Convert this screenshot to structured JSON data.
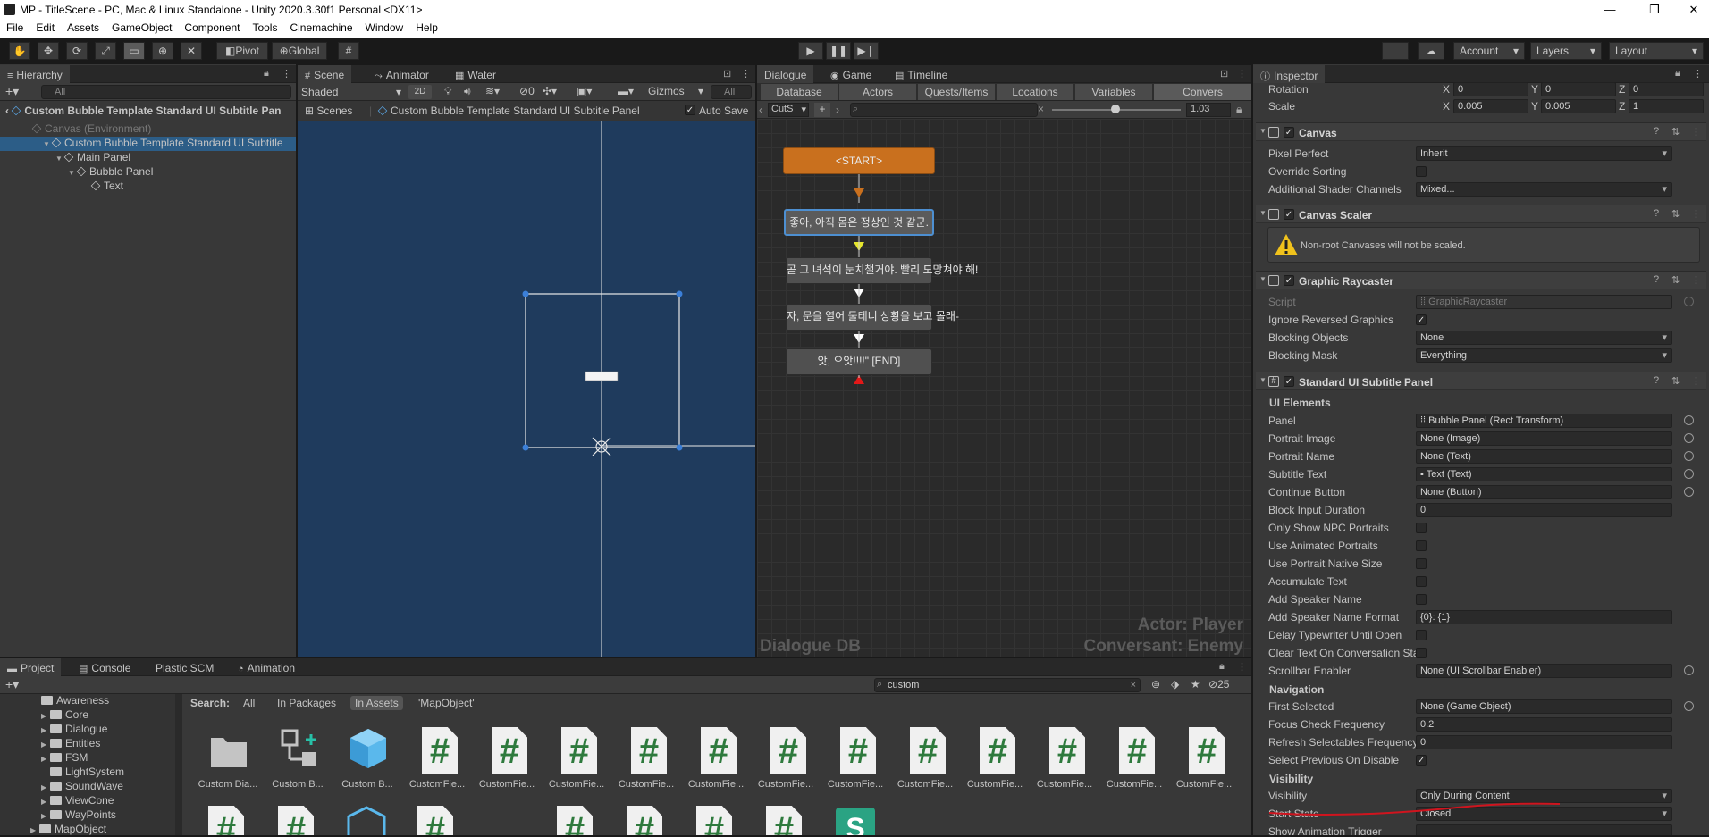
{
  "window": {
    "title": "MP - TitleScene - PC, Mac & Linux Standalone - Unity 2020.3.30f1 Personal <DX11>"
  },
  "menu": [
    "File",
    "Edit",
    "Assets",
    "GameObject",
    "Component",
    "Tools",
    "Cinemachine",
    "Window",
    "Help"
  ],
  "toolbar": {
    "pivot": "Pivot",
    "global": "Global",
    "account": "Account",
    "layers": "Layers",
    "layout": "Layout"
  },
  "hierarchy": {
    "tab": "Hierarchy",
    "search_placeholder": "All",
    "scene_header": "Custom Bubble Template Standard UI Subtitle Pan",
    "items": [
      {
        "label": "Canvas (Environment)"
      },
      {
        "label": "Custom Bubble Template Standard UI Subtitle"
      },
      {
        "label": "Main Panel"
      },
      {
        "label": "Bubble Panel"
      },
      {
        "label": "Text"
      }
    ]
  },
  "scene": {
    "tabs": [
      "Scene",
      "Animator",
      "Water"
    ],
    "shading": "Shaded",
    "mode_2d": "2D",
    "hidden_count": "0",
    "gizmos": "Gizmos",
    "search_placeholder": "All",
    "breadcrumb_root": "Scenes",
    "breadcrumb_prefab": "Custom Bubble Template Standard UI Subtitle Panel",
    "auto_save": "Auto Save"
  },
  "dialogue": {
    "tabs": [
      "Dialogue",
      "Game",
      "Timeline"
    ],
    "subtabs": [
      "Database",
      "Actors",
      "Quests/Items",
      "Locations",
      "Variables",
      "Convers"
    ],
    "conversation": "CutS",
    "add": "+",
    "zoom": "1.03",
    "nodes": {
      "start": "<START>",
      "n1": "좋아, 아직 몸은 정상인 것 같군.",
      "n2": "곧 그 녀석이 눈치챌거야. 빨리 도망쳐야 해!",
      "n3": "자, 문을 열어 둘테니 상황을 보고 몰래-",
      "n4": "앗, 으앗!!!!\" [END]"
    },
    "db_label": "Dialogue DB",
    "actor": "Actor: Player",
    "conversant": "Conversant: Enemy"
  },
  "project": {
    "tabs": [
      "Project",
      "Console",
      "Plastic SCM",
      "Animation"
    ],
    "search_value": "custom",
    "hidden_count": "25",
    "search_label": "Search:",
    "filters": [
      "All",
      "In Packages",
      "In Assets",
      "'MapObject'"
    ],
    "tree": [
      "Awareness",
      "Core",
      "Dialogue",
      "Entities",
      "FSM",
      "LightSystem",
      "SoundWave",
      "ViewCone",
      "WayPoints",
      "MapObject"
    ],
    "assets": [
      "Custom Dia...",
      "Custom B...",
      "Custom B...",
      "CustomFie...",
      "CustomFie...",
      "CustomFie...",
      "CustomFie...",
      "CustomFie...",
      "CustomFie...",
      "CustomFie...",
      "CustomFie...",
      "CustomFie...",
      "CustomFie...",
      "CustomFie...",
      "CustomFie..."
    ]
  },
  "inspector": {
    "tab": "Inspector",
    "transform": {
      "rotation_label": "Rotation",
      "rx": "0",
      "ry": "0",
      "rz": "0",
      "scale_label": "Scale",
      "sx": "0.005",
      "sy": "0.005",
      "sz": "1"
    },
    "canvas": {
      "title": "Canvas",
      "pixel_perfect": "Pixel Perfect",
      "pixel_perfect_val": "Inherit",
      "override_sorting": "Override Sorting",
      "shader_channels": "Additional Shader Channels",
      "shader_channels_val": "Mixed..."
    },
    "canvas_scaler": {
      "title": "Canvas Scaler",
      "warning": "Non-root Canvases will not be scaled."
    },
    "raycaster": {
      "title": "Graphic Raycaster",
      "script": "Script",
      "script_val": "GraphicRaycaster",
      "ignore_reversed": "Ignore Reversed Graphics",
      "blocking_objects": "Blocking Objects",
      "blocking_objects_val": "None",
      "blocking_mask": "Blocking Mask",
      "blocking_mask_val": "Everything"
    },
    "subtitle": {
      "title": "Standard UI Subtitle Panel",
      "ui_elements": "UI Elements",
      "panel": "Panel",
      "panel_val": "Bubble Panel (Rect Transform)",
      "portrait_image": "Portrait Image",
      "portrait_image_val": "None (Image)",
      "portrait_name": "Portrait Name",
      "portrait_name_val": "None (Text)",
      "subtitle_text": "Subtitle Text",
      "subtitle_text_val": "Text (Text)",
      "continue_button": "Continue Button",
      "continue_button_val": "None (Button)",
      "block_input": "Block Input Duration",
      "block_input_val": "0",
      "only_npc": "Only Show NPC Portraits",
      "use_animated": "Use Animated Portraits",
      "native_size": "Use Portrait Native Size",
      "accumulate": "Accumulate Text",
      "add_speaker": "Add Speaker Name",
      "speaker_format": "Add Speaker Name Format",
      "speaker_format_val": "{0}: {1}",
      "delay_typewriter": "Delay Typewriter Until Open",
      "clear_text": "Clear Text On Conversation Start",
      "scrollbar": "Scrollbar Enabler",
      "scrollbar_val": "None (UI Scrollbar Enabler)",
      "navigation": "Navigation",
      "first_selected": "First Selected",
      "first_selected_val": "None (Game Object)",
      "focus_freq": "Focus Check Frequency",
      "focus_freq_val": "0.2",
      "refresh_freq": "Refresh Selectables Frequency",
      "refresh_freq_val": "0",
      "select_prev": "Select Previous On Disable",
      "visibility_head": "Visibility",
      "visibility": "Visibility",
      "visibility_val": "Only During Content",
      "start_state": "Start State",
      "start_state_val": "Closed",
      "show_anim": "Show Animation Trigger"
    }
  },
  "colors": {
    "accent": "#2c5d87",
    "start_node": "#c9701e",
    "annotation": "#d0141e"
  }
}
